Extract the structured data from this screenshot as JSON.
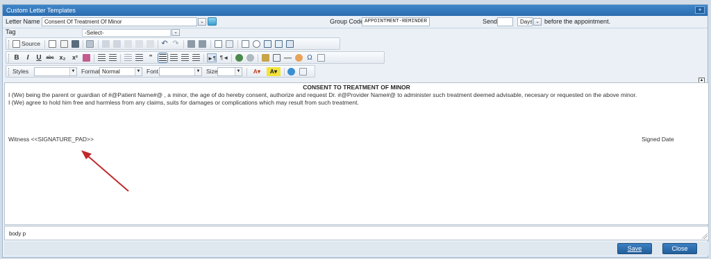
{
  "window": {
    "title": "Custom Letter Templates",
    "plus_label": "+"
  },
  "letter": {
    "label": "Letter Name",
    "value": "Consent Of Treatment Of Minor"
  },
  "group": {
    "label": "Group Code:",
    "value": "APPOINTMENT-REMINDER"
  },
  "send": {
    "label": "Send",
    "value": "",
    "unit": "Days",
    "suffix": "before the appointment."
  },
  "tag": {
    "label": "Tag",
    "value": "-Select-"
  },
  "toolbar": {
    "source_label": "Source",
    "styles_label": "Styles",
    "format_label": "Format",
    "format_value": "Normal",
    "font_label": "Font",
    "size_label": "Size"
  },
  "editor": {
    "title": "CONSENT TO TREATMENT OF MINOR",
    "line1": "I (We) being the parent or guardian of  #@Patient Name#@ , a minor, the age of        do hereby consent, authorize and request Dr. #@Provider Name#@ to administer such treatment deemed advisable, necesary or requested on the above minor.",
    "line2": "I (We) agree to hold him free and harmless from any claims, suits for damages or complications which may result from such treatment.",
    "witness": "Witness   <<SIGNATURE_PAD>>",
    "signed_date": "Signed Date"
  },
  "status": {
    "path": "body  p"
  },
  "buttons": {
    "save": "Save",
    "close": "Close"
  },
  "colors": {
    "accent": "#2b6db0",
    "annotation_arrow": "#c0282a"
  }
}
